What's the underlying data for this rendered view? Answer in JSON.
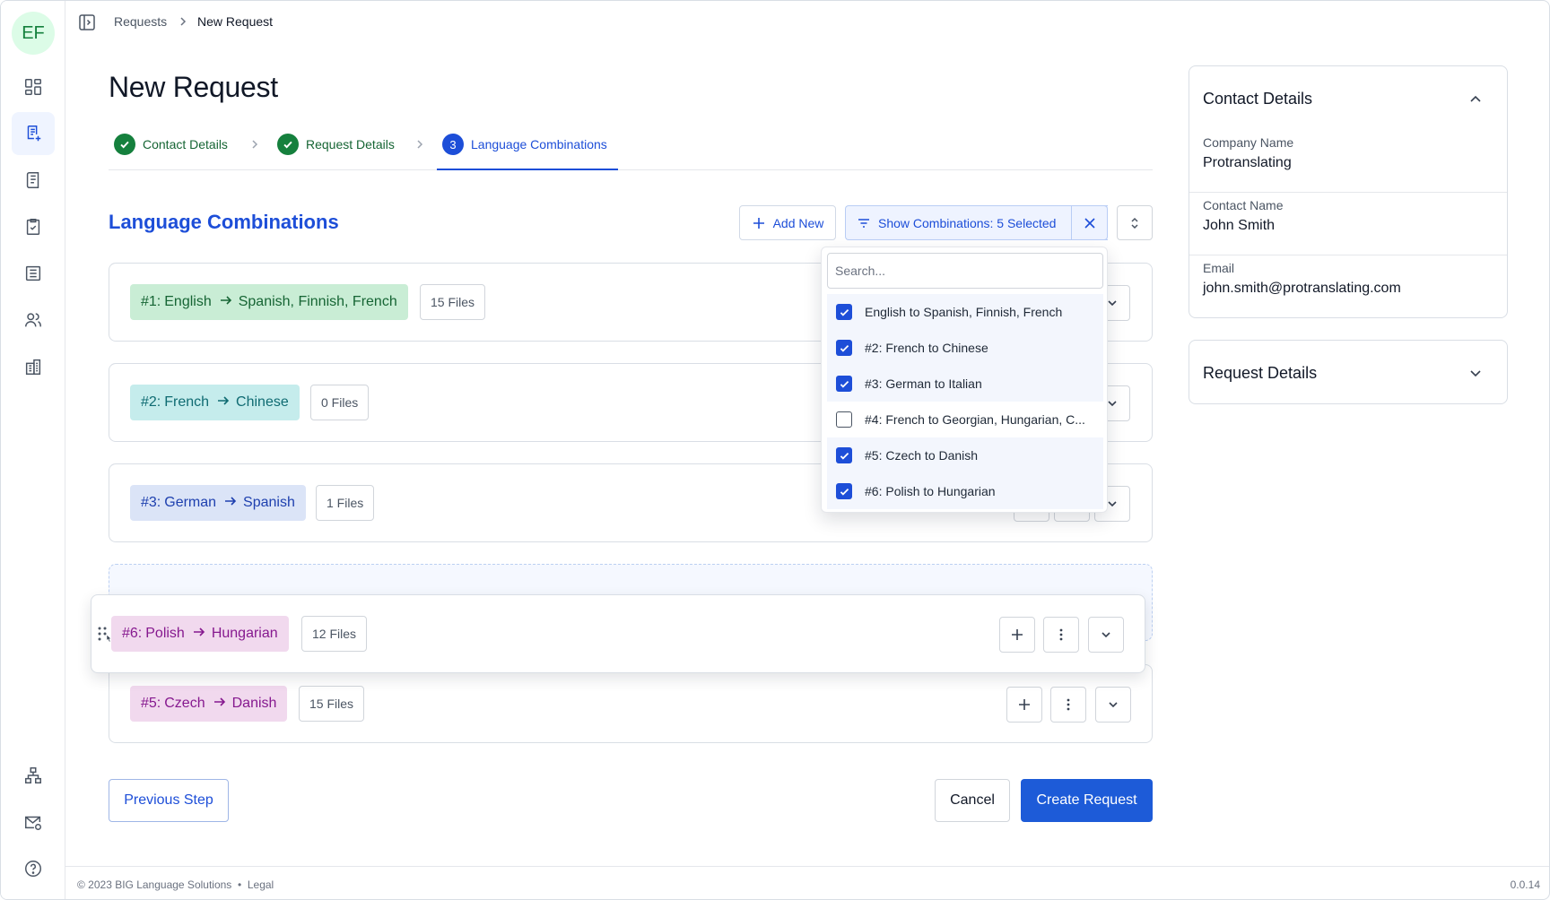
{
  "user": {
    "initials": "EF"
  },
  "breadcrumb": {
    "parent": "Requests",
    "current": "New Request"
  },
  "page": {
    "title": "New Request"
  },
  "steps": [
    {
      "label": "Contact Details",
      "state": "done"
    },
    {
      "label": "Request Details",
      "state": "done"
    },
    {
      "label": "Language Combinations",
      "state": "current",
      "number": "3"
    }
  ],
  "section": {
    "title": "Language Combinations",
    "add_new_label": "Add New",
    "filter_label": "Show Combinations: 5 Selected"
  },
  "combinations": [
    {
      "id": "#1:",
      "source": "English",
      "targets": "Spanish,  Finnish, French",
      "files": "15 Files"
    },
    {
      "id": "#2:",
      "source": "French",
      "targets": "Chinese",
      "files": "0 Files"
    },
    {
      "id": "#3:",
      "source": "German",
      "targets": "Spanish",
      "files": "1 Files"
    },
    {
      "id": "#6:",
      "source": "Polish",
      "targets": "Hungarian",
      "files": "12 Files"
    },
    {
      "id": "#5:",
      "source": "Czech",
      "targets": "Danish",
      "files": "15 Files"
    }
  ],
  "filter_dropdown": {
    "search_placeholder": "Search...",
    "options": [
      {
        "label": "English to Spanish,  Finnish, French",
        "checked": true
      },
      {
        "label": "#2: French to Chinese",
        "checked": true
      },
      {
        "label": "#3: German to Italian",
        "checked": true
      },
      {
        "label": "#4: French to Georgian, Hungarian, C...",
        "checked": false
      },
      {
        "label": "#5: Czech to Danish",
        "checked": true
      },
      {
        "label": "#6: Polish to Hungarian",
        "checked": true
      }
    ]
  },
  "actions": {
    "previous": "Previous Step",
    "cancel": "Cancel",
    "create": "Create Request"
  },
  "contact_details": {
    "title": "Contact Details",
    "company_label": "Company Name",
    "company_value": "Protranslating",
    "contact_label": "Contact Name",
    "contact_value": "John Smith",
    "email_label": "Email",
    "email_value": "john.smith@protranslating.com"
  },
  "request_details": {
    "title": "Request Details"
  },
  "footer": {
    "copyright": "© 2023 BIG Language Solutions",
    "legal": "Legal",
    "version": "0.0.14"
  },
  "colors": {
    "primary": "#1d4ed8",
    "success": "#15803d",
    "tag_green": "#c9edd5",
    "tag_teal": "#c5ecec",
    "tag_blue": "#dbe4f7",
    "tag_pink": "#f1d9ee"
  }
}
